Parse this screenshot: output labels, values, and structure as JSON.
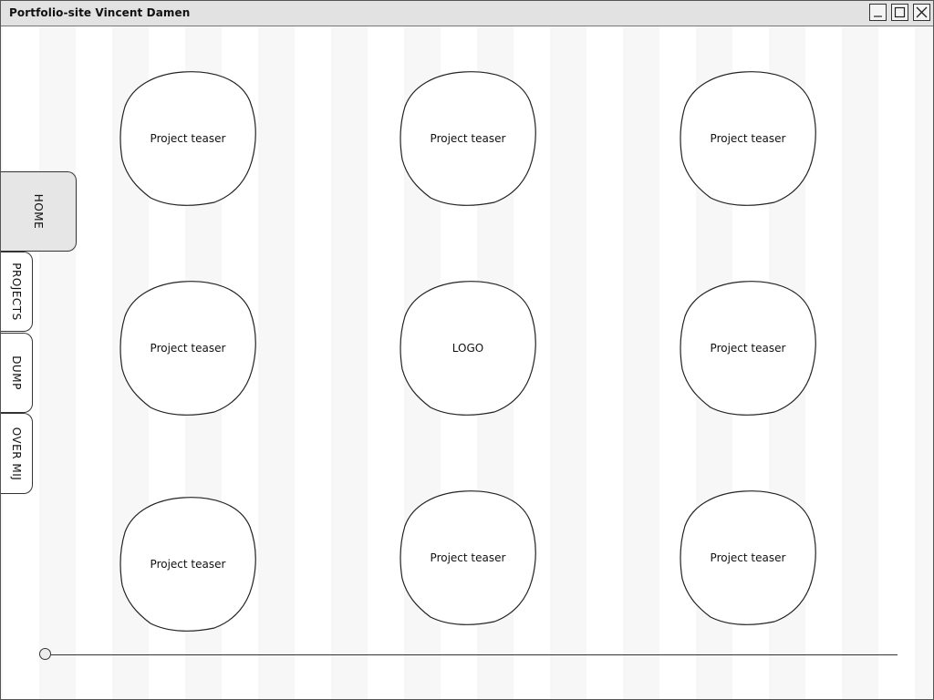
{
  "window": {
    "title": "Portfolio-site Vincent Damen",
    "minimize_icon": "minimize-icon",
    "maximize_icon": "maximize-icon",
    "close_icon": "close-icon"
  },
  "nav": {
    "tabs": [
      {
        "label": "HOME",
        "active": true
      },
      {
        "label": "PROJECTS",
        "active": false
      },
      {
        "label": "DUMP",
        "active": false
      },
      {
        "label": "OVER MIJ",
        "active": false
      }
    ]
  },
  "grid": {
    "items": [
      {
        "label": "Project teaser"
      },
      {
        "label": "Project teaser"
      },
      {
        "label": "Project teaser"
      },
      {
        "label": "Project teaser"
      },
      {
        "label": "LOGO"
      },
      {
        "label": "Project teaser"
      },
      {
        "label": "Project teaser"
      },
      {
        "label": "Project teaser"
      },
      {
        "label": "Project teaser"
      }
    ]
  },
  "slider": {
    "value": 0
  },
  "colors": {
    "background": "#ffffff",
    "stripe": "#f7f7f7",
    "titlebar": "#e2e2e2",
    "active_tab": "#e6e6e6",
    "stroke": "#333333"
  }
}
